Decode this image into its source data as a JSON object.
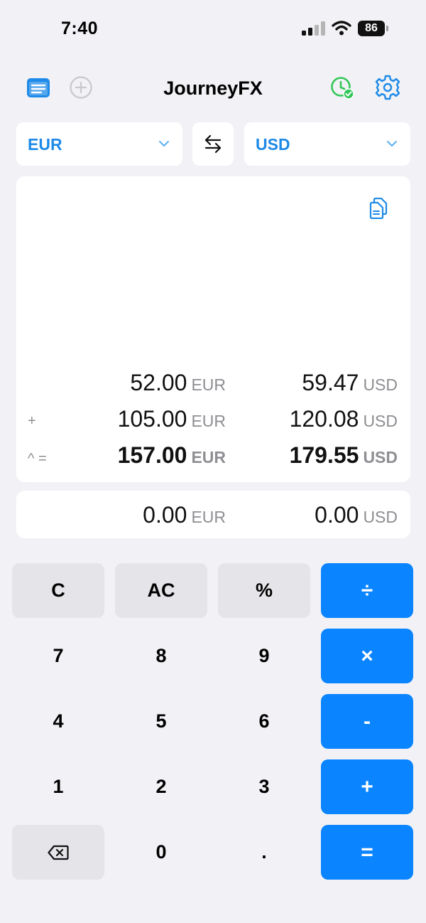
{
  "status": {
    "time": "7:40",
    "battery": "86"
  },
  "nav": {
    "title": "JourneyFX",
    "icons": [
      "list-icon",
      "add-circle-icon",
      "clock-check-icon",
      "gear-icon"
    ]
  },
  "selectors": {
    "from": "EUR",
    "to": "USD"
  },
  "history": {
    "rows": [
      {
        "op": "",
        "left_amount": "52.00",
        "left_unit": "EUR",
        "right_amount": "59.47",
        "right_unit": "USD"
      },
      {
        "op": "+",
        "left_amount": "105.00",
        "left_unit": "EUR",
        "right_amount": "120.08",
        "right_unit": "USD"
      },
      {
        "op": "^ =",
        "left_amount": "157.00",
        "left_unit": "EUR",
        "right_amount": "179.55",
        "right_unit": "USD"
      }
    ]
  },
  "current": {
    "left_amount": "0.00",
    "left_unit": "EUR",
    "right_amount": "0.00",
    "right_unit": "USD"
  },
  "keypad": {
    "c": "C",
    "ac": "AC",
    "percent": "%",
    "divide": "÷",
    "k7": "7",
    "k8": "8",
    "k9": "9",
    "multiply": "×",
    "k4": "4",
    "k5": "5",
    "k6": "6",
    "minus": "-",
    "k1": "1",
    "k2": "2",
    "k3": "3",
    "plus": "+",
    "k0": "0",
    "dot": ".",
    "equals": "="
  },
  "colors": {
    "accent": "#0a84ff",
    "label_blue": "#1d8ae8",
    "green": "#34c759",
    "background": "#f2f2f6"
  }
}
